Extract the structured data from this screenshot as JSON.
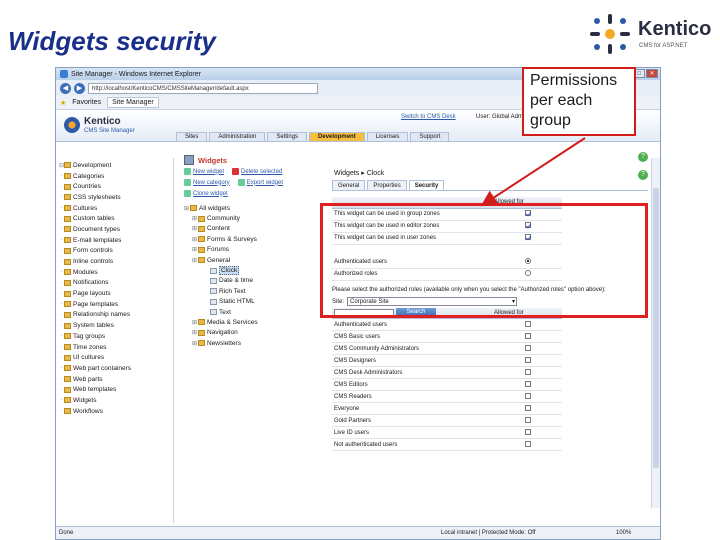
{
  "slide": {
    "title": "Widgets security"
  },
  "logo": {
    "word": "Kentico",
    "sub": "CMS for ASP.NET"
  },
  "callout": {
    "text": "Permissions per each group"
  },
  "browser": {
    "window_title": "Site Manager - Windows Internet Explorer",
    "address": "http://localhost/KenticoCMS/CMSSiteManager/default.aspx",
    "favorites": "Favorites",
    "tab": "Site Manager",
    "status_left": "Done",
    "status_zone": "Local intranet | Protected Mode: Off",
    "status_zoom": "100%"
  },
  "cms": {
    "brand": "Kentico",
    "brand_sub": "CMS Site Manager",
    "nav": [
      "Sites",
      "Administration",
      "Settings",
      "Development",
      "Licenses",
      "Support"
    ],
    "active_nav": "Development",
    "switch": "Switch to CMS Desk",
    "user": "User: Global Administrator"
  },
  "left_tree": {
    "root": "Development",
    "items": [
      "Categories",
      "Countries",
      "CSS stylesheets",
      "Cultures",
      "Custom tables",
      "Document types",
      "E-mail templates",
      "Form controls",
      "Inline controls",
      "Modules",
      "Notifications",
      "Page layouts",
      "Page templates",
      "Relationship names",
      "System tables",
      "Tag groups",
      "Time zones",
      "UI cultures",
      "Web part containers",
      "Web parts",
      "Web templates",
      "Widgets",
      "Workflows"
    ]
  },
  "widgets_panel": {
    "title": "Widgets",
    "actions": [
      "New widget",
      "Delete selected",
      "New category",
      "Export widget",
      "Clone widget"
    ],
    "tree_root": "All widgets",
    "categories": [
      "Community",
      "Content",
      "Forms & Surveys",
      "Forums",
      "General"
    ],
    "general_children": [
      "Clock",
      "Date & time",
      "Rich Text",
      "Static HTML",
      "Text"
    ],
    "categories_after": [
      "Media & Services",
      "Navigation",
      "Newsletters"
    ]
  },
  "detail": {
    "breadcrumb": "Widgets  ▸  Clock",
    "tabs": [
      "General",
      "Properties",
      "Security"
    ],
    "active_tab": "Security",
    "allowed_for_header": "Allowed for",
    "zone_rows": [
      {
        "label": "This widget can be used in group zones",
        "checked": true
      },
      {
        "label": "This widget can be used in editor zones",
        "checked": true
      },
      {
        "label": "This widget can be used in user zones",
        "checked": true
      }
    ],
    "access_rows": [
      {
        "label": "Authenticated users",
        "selected": true
      },
      {
        "label": "Authorized roles",
        "selected": false
      }
    ],
    "roles_note": "Please select the authorized roles (available only when you select the \"Authorized roles\" option above):",
    "site_label": "Site:",
    "site_value": "Corporate Site",
    "search_button": "Search",
    "roles_header": "Allowed for",
    "roles": [
      "Authenticated users",
      "CMS Basic users",
      "CMS Community Administrators",
      "CMS Designers",
      "CMS Desk Administrators",
      "CMS Editors",
      "CMS Readers",
      "Everyone",
      "Gold Partners",
      "Live ID users",
      "Not authenticated users"
    ]
  },
  "colors": {
    "title": "#1a2f8a",
    "highlight": "#e02020",
    "active_tab": "#f5c040"
  }
}
